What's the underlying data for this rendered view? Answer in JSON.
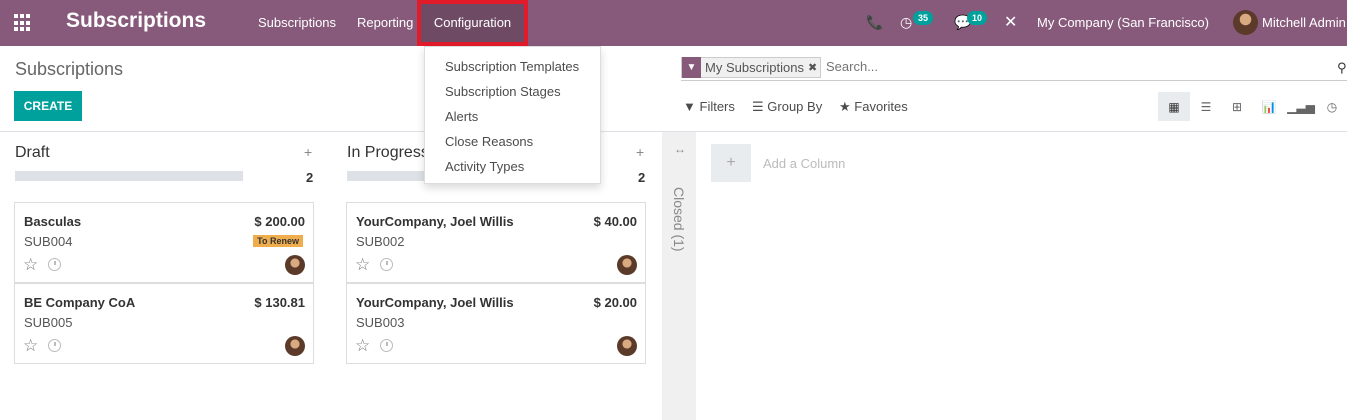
{
  "navbar": {
    "brand": "Subscriptions",
    "menu": [
      "Subscriptions",
      "Reporting",
      "Configuration"
    ],
    "activity_count": "35",
    "message_count": "10",
    "company": "My Company (San Francisco)",
    "user": "Mitchell Admin",
    "bg_color": "#875a7b"
  },
  "dropdown": {
    "items": [
      "Subscription Templates",
      "Subscription Stages",
      "Alerts",
      "Close Reasons",
      "Activity Types"
    ]
  },
  "control": {
    "title": "Subscriptions",
    "create_label": "CREATE",
    "facet_label": "My Subscriptions",
    "search_placeholder": "Search...",
    "filters_label": "Filters",
    "groupby_label": "Group By",
    "favorites_label": "Favorites",
    "views": [
      "kanban",
      "list",
      "pivot",
      "graph",
      "cohort",
      "activity"
    ]
  },
  "kanban": {
    "columns": [
      {
        "title": "Draft",
        "count": "2",
        "cards": [
          {
            "name": "Basculas",
            "ref": "SUB004",
            "amount": "$ 200.00",
            "tag": "To Renew"
          },
          {
            "name": "BE Company CoA",
            "ref": "SUB005",
            "amount": "$ 130.81",
            "tag": ""
          }
        ]
      },
      {
        "title": "In Progress",
        "count": "2",
        "cards": [
          {
            "name": "YourCompany, Joel Willis",
            "ref": "SUB002",
            "amount": "$ 40.00",
            "tag": ""
          },
          {
            "name": "YourCompany, Joel Willis",
            "ref": "SUB003",
            "amount": "$ 20.00",
            "tag": ""
          }
        ]
      }
    ],
    "closed_label": "Closed (1)",
    "add_column_label": "Add a Column"
  }
}
